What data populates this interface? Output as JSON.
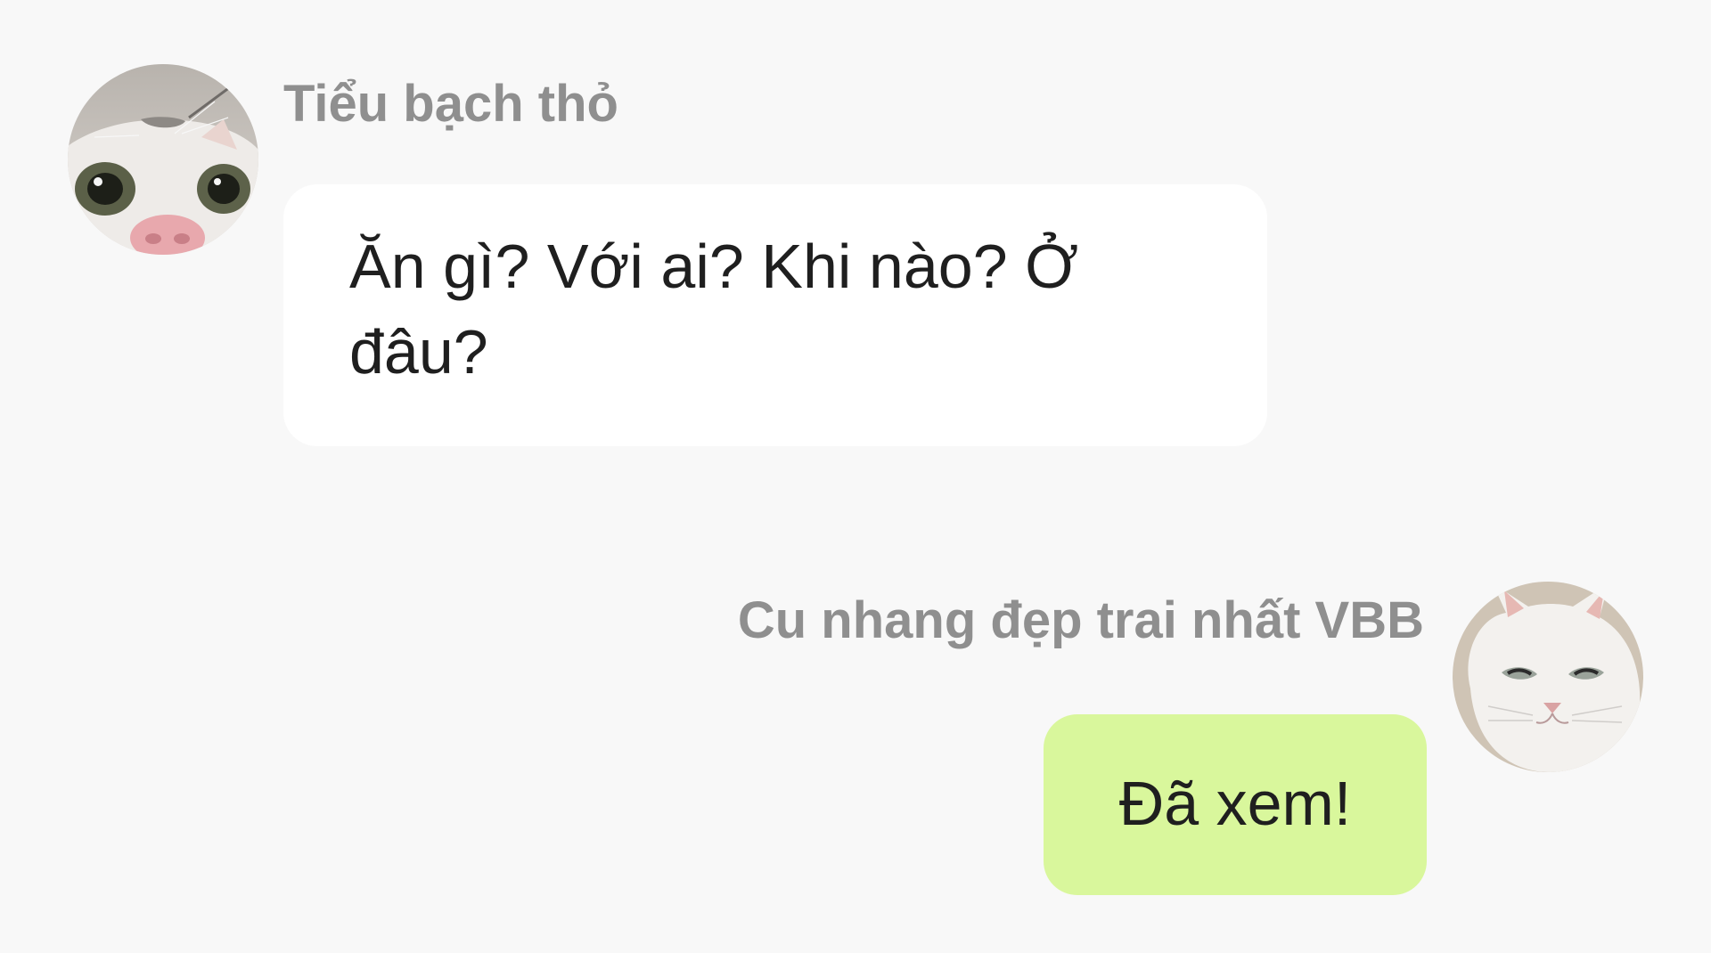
{
  "messages": [
    {
      "sender": "Tiểu bạch thỏ",
      "text": "Ăn gì? Với ai? Khi nào? Ở đâu?",
      "avatar_icon": "cat-face-close-up-avatar"
    },
    {
      "sender": "Cu nhang đẹp trai nhất VBB",
      "text": "Đã xem!",
      "avatar_icon": "white-cat-avatar"
    }
  ],
  "colors": {
    "background": "#f8f8f8",
    "incoming_bubble": "#ffffff",
    "outgoing_bubble": "#d9f79c",
    "sender_name": "#8f8f8f",
    "message_text": "#1f1f1f"
  }
}
